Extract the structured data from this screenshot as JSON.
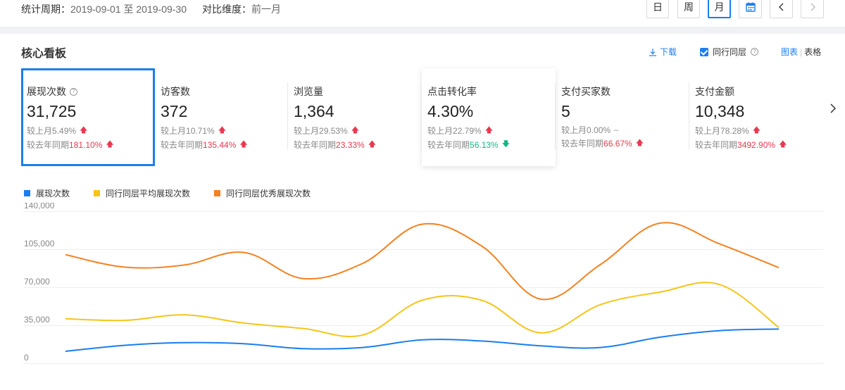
{
  "filter": {
    "period_label": "统计周期：",
    "period_value": "2019-09-01 至 2019-09-30",
    "compare_label": "对比维度：",
    "compare_value": "前一月",
    "buttons": [
      {
        "label": "日"
      },
      {
        "label": "周"
      },
      {
        "label": "月",
        "active": true
      }
    ],
    "calendar_icon": "calendar-icon",
    "prev_icon": "chevron-left-icon",
    "next_icon": "chevron-right-icon"
  },
  "board": {
    "title": "核心看板",
    "download_label": "下载",
    "peer_label": "同行同层",
    "view_chart": "图表",
    "view_table": "表格"
  },
  "metrics": [
    {
      "name": "展现次数",
      "value": "31,725",
      "mom_label": "较上月",
      "mom": "5.49%",
      "mom_dir": "up",
      "yoy_label": "较去年同期",
      "yoy": "181.10%",
      "yoy_dir": "up"
    },
    {
      "name": "访客数",
      "value": "372",
      "mom_label": "较上月",
      "mom": "10.71%",
      "mom_dir": "up",
      "yoy_label": "较去年同期",
      "yoy": "135.44%",
      "yoy_dir": "up"
    },
    {
      "name": "浏览量",
      "value": "1,364",
      "mom_label": "较上月",
      "mom": "29.53%",
      "mom_dir": "up",
      "yoy_label": "较去年同期",
      "yoy": "23.33%",
      "yoy_dir": "up"
    },
    {
      "name": "点击转化率",
      "value": "4.30%",
      "mom_label": "较上月",
      "mom": "22.79%",
      "mom_dir": "up",
      "yoy_label": "较去年同期",
      "yoy": "56.13%",
      "yoy_dir": "down"
    },
    {
      "name": "支付买家数",
      "value": "5",
      "mom_label": "较上月",
      "mom": "0.00%",
      "mom_dir": "flat",
      "yoy_label": "较去年同期",
      "yoy": "66.67%",
      "yoy_dir": "up"
    },
    {
      "name": "支付金额",
      "value": "10,348",
      "mom_label": "较上月",
      "mom": "78.28%",
      "mom_dir": "up",
      "yoy_label": "较去年同期",
      "yoy": "3492.90%",
      "yoy_dir": "up"
    }
  ],
  "colors": {
    "accent": "#1a7ef0",
    "up": "#e8384f",
    "down": "#12b886",
    "series1": "#1a7ef0",
    "series2": "#f5c518",
    "series3": "#f58220"
  },
  "chart_data": {
    "type": "line",
    "yticks": [
      "140,000",
      "105,000",
      "70,000",
      "35,000",
      "0"
    ],
    "ylim": [
      0,
      140000
    ],
    "x": [
      1,
      2,
      3,
      4,
      5,
      6,
      7,
      8,
      9,
      10,
      11,
      12
    ],
    "series": [
      {
        "name": "展现次数",
        "color": "#1a7ef0",
        "values": [
          11000,
          16500,
          19000,
          18000,
          13500,
          14500,
          21500,
          20500,
          16000,
          14500,
          24000,
          30000,
          31500
        ]
      },
      {
        "name": "同行同层平均展现次数",
        "color": "#f5c518",
        "values": [
          41000,
          39500,
          44500,
          37000,
          32000,
          26000,
          58000,
          58000,
          28000,
          54000,
          65500,
          72500,
          33000
        ]
      },
      {
        "name": "同行同层优秀展现次数",
        "color": "#f58220",
        "values": [
          100000,
          88500,
          90500,
          102000,
          78000,
          92000,
          128000,
          108000,
          59000,
          91000,
          129000,
          110000,
          88000
        ]
      }
    ]
  }
}
